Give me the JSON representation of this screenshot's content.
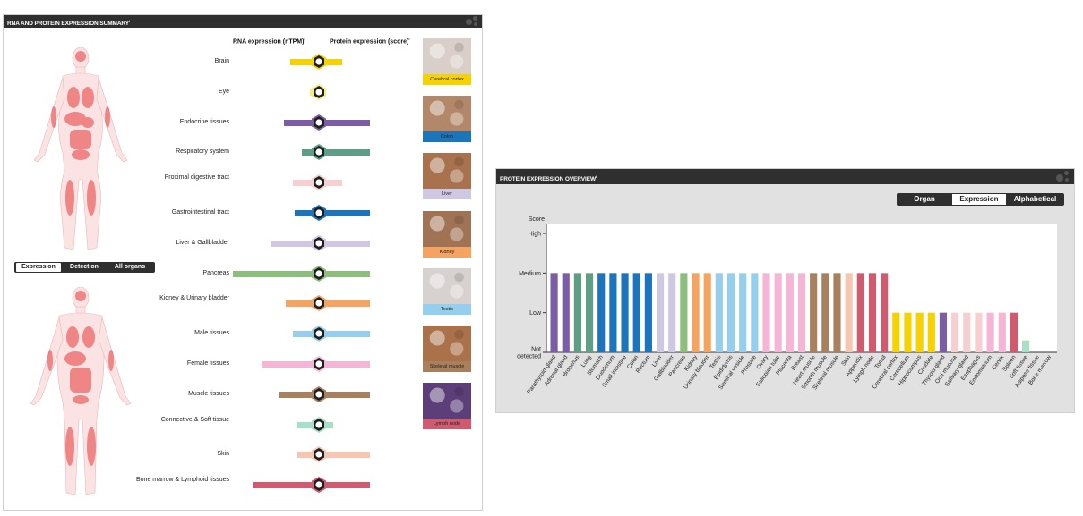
{
  "summary": {
    "title": "RNA AND PROTEIN EXPRESSION SUMMARY",
    "info_mark": "i",
    "rna_header": "RNA expression (nTPM)",
    "protein_header": "Protein expression (score)",
    "toggle": [
      "Expression",
      "Detection",
      "All organs"
    ],
    "tissues": [
      {
        "name": "Brain",
        "rna": 33,
        "protein": 14,
        "color": "#f5d200",
        "icon": "brain-icon"
      },
      {
        "name": "Eye",
        "rna": 10,
        "protein": 0,
        "color": "#f9ec7a",
        "icon": "eye-icon"
      },
      {
        "name": "Endocrine tissues",
        "rna": 40,
        "protein": 45,
        "color": "#7b5ca6",
        "icon": "thyroid-icon"
      },
      {
        "name": "Respiratory system",
        "rna": 19,
        "protein": 45,
        "color": "#5d9f86",
        "icon": "lung-icon"
      },
      {
        "name": "Proximal digestive tract",
        "rna": 30,
        "protein": 14,
        "color": "#f6d0d0",
        "icon": "mouth-icon"
      },
      {
        "name": "Gastrointestinal tract",
        "rna": 28,
        "protein": 45,
        "color": "#1a75bc",
        "icon": "stomach-icon"
      },
      {
        "name": "Liver & Gallbladder",
        "rna": 55,
        "protein": 45,
        "color": "#cfc8e3",
        "icon": "liver-icon"
      },
      {
        "name": "Pancreas",
        "rna": 98,
        "protein": 45,
        "color": "#8dbf7c",
        "icon": "pancreas-icon"
      },
      {
        "name": "Kidney & Urinary bladder",
        "rna": 38,
        "protein": 45,
        "color": "#f4a361",
        "icon": "kidney-icon"
      },
      {
        "name": "Male tissues",
        "rna": 30,
        "protein": 45,
        "color": "#96cfee",
        "icon": "male-icon"
      },
      {
        "name": "Female tissues",
        "rna": 65,
        "protein": 45,
        "color": "#f5b6d6",
        "icon": "female-icon"
      },
      {
        "name": "Muscle tissues",
        "rna": 45,
        "protein": 45,
        "color": "#a8805d",
        "icon": "muscle-icon"
      },
      {
        "name": "Connective & Soft tissue",
        "rna": 26,
        "protein": 4,
        "color": "#a8dfc8",
        "icon": "cell-icon"
      },
      {
        "name": "Skin",
        "rna": 24,
        "protein": 45,
        "color": "#f8c6b0",
        "icon": "skin-icon"
      },
      {
        "name": "Bone marrow & Lymphoid tissues",
        "rna": 76,
        "protein": 45,
        "color": "#d05b6e",
        "icon": "lymph-icon"
      }
    ],
    "images": [
      {
        "caption": "Cerebral cortex",
        "cap_color": "#f5d200",
        "tint": "#d9cfc8"
      },
      {
        "caption": "Colon",
        "cap_color": "#1a75bc",
        "tint": "#b3886a"
      },
      {
        "caption": "Liver",
        "cap_color": "#cfc8e3",
        "tint": "#a7724d"
      },
      {
        "caption": "Kidney",
        "cap_color": "#f4a361",
        "tint": "#a07355"
      },
      {
        "caption": "Testis",
        "cap_color": "#96cfee",
        "tint": "#d7d2d0"
      },
      {
        "caption": "Skeletal muscle",
        "cap_color": "#a8805d",
        "tint": "#a9724a"
      },
      {
        "caption": "Lymph node",
        "cap_color": "#d05b6e",
        "tint": "#5c3f78"
      }
    ]
  },
  "overview": {
    "title": "PROTEIN EXPRESSION OVERVIEW",
    "info_mark": "i",
    "toggle": [
      "Organ",
      "Expression",
      "Alphabetical"
    ],
    "selected_toggle": "Expression"
  },
  "chart_data": {
    "type": "bar",
    "ylabel": "Score",
    "y_levels": [
      "Not detected",
      "Low",
      "Medium",
      "High"
    ],
    "ylim": [
      0,
      3
    ],
    "categories": [
      "Parathyroid gland",
      "Adrenal gland",
      "Bronchus",
      "Lung",
      "Stomach",
      "Duodenum",
      "Small intestine",
      "Colon",
      "Rectum",
      "Liver",
      "Gallbladder",
      "Pancreas",
      "Kidney",
      "Urinary bladder",
      "Testis",
      "Epididymis",
      "Seminal vesicle",
      "Prostate",
      "Ovary",
      "Fallopian tube",
      "Placenta",
      "Breast",
      "Heart muscle",
      "Smooth muscle",
      "Skeletal muscle",
      "Skin",
      "Appendix",
      "Lymph node",
      "Tonsil",
      "Cerebral cortex",
      "Cerebellum",
      "Hippocampus",
      "Caudate",
      "Thyroid gland",
      "Oral mucosa",
      "Salivary gland",
      "Esophagus",
      "Endometrium",
      "Cervix",
      "Spleen",
      "Soft tissue",
      "Adipose tissue",
      "Bone marrow"
    ],
    "values": [
      2,
      2,
      2,
      2,
      2,
      2,
      2,
      2,
      2,
      2,
      2,
      2,
      2,
      2,
      2,
      2,
      2,
      2,
      2,
      2,
      2,
      2,
      2,
      2,
      2,
      2,
      2,
      2,
      2,
      1,
      1,
      1,
      1,
      1,
      1,
      1,
      1,
      1,
      1,
      1,
      0.3,
      0,
      0
    ],
    "colors": [
      "#7b5ca6",
      "#7b5ca6",
      "#5d9f86",
      "#5d9f86",
      "#1a75bc",
      "#1a75bc",
      "#1a75bc",
      "#1a75bc",
      "#1a75bc",
      "#cfc8e3",
      "#cfc8e3",
      "#8dbf7c",
      "#f4a361",
      "#f4a361",
      "#96cfee",
      "#96cfee",
      "#96cfee",
      "#96cfee",
      "#f5b6d6",
      "#f5b6d6",
      "#f5b6d6",
      "#f5b6d6",
      "#a8805d",
      "#a8805d",
      "#a8805d",
      "#f8c6b0",
      "#d05b6e",
      "#d05b6e",
      "#d05b6e",
      "#f5d200",
      "#f5d200",
      "#f5d200",
      "#f5d200",
      "#7b5ca6",
      "#f6d0d0",
      "#f6d0d0",
      "#f6d0d0",
      "#f5b6d6",
      "#f5b6d6",
      "#d05b6e",
      "#a8dfc8",
      "#a8dfc8",
      "#d05b6e"
    ],
    "grid": false,
    "legend": "none"
  }
}
